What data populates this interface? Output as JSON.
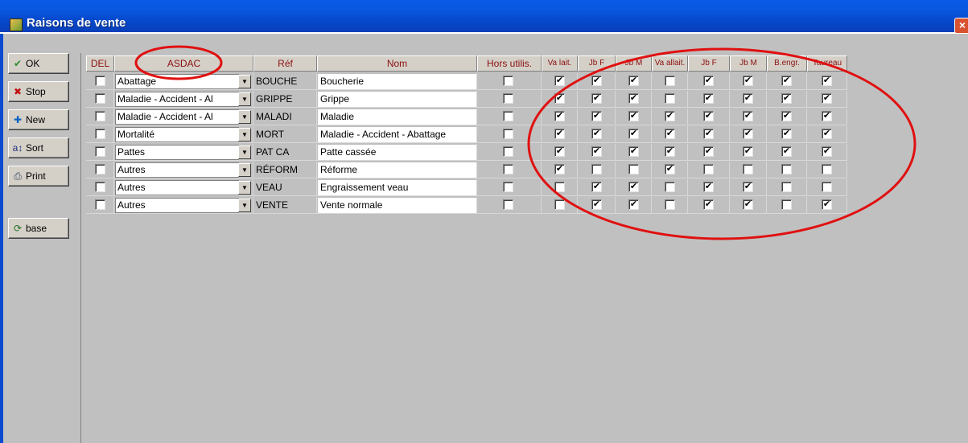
{
  "window": {
    "title": "Raisons de vente",
    "close_glyph": "×"
  },
  "toolbar": {
    "buttons": [
      {
        "label": "OK",
        "icon": "checkmark-icon"
      },
      {
        "label": "Stop",
        "icon": "stop-icon"
      },
      {
        "label": "New",
        "icon": "new-icon"
      },
      {
        "label": "Sort",
        "icon": "sort-icon"
      },
      {
        "label": "Print",
        "icon": "printer-icon"
      },
      {
        "label": "base",
        "icon": "database-icon"
      }
    ]
  },
  "grid": {
    "headers": [
      "DEL",
      "ASDAC",
      "Réf",
      "Nom",
      "Hors utilis.",
      "Va lait.",
      "Jb F",
      "Jb M",
      "Va allait.",
      "Jb F",
      "Jb M",
      "B.engr.",
      "Taureau"
    ],
    "rows": [
      {
        "del": false,
        "asdac": "Abattage",
        "ref": "BOUCHE",
        "nom": "Boucherie",
        "hors": false,
        "flags": [
          true,
          true,
          true,
          false,
          true,
          true,
          true,
          true
        ]
      },
      {
        "del": false,
        "asdac": "Maladie - Accident - Al",
        "ref": "GRIPPE",
        "nom": "Grippe",
        "hors": false,
        "flags": [
          true,
          true,
          true,
          false,
          true,
          true,
          true,
          true
        ]
      },
      {
        "del": false,
        "asdac": "Maladie - Accident - Al",
        "ref": "MALADI",
        "nom": "Maladie",
        "hors": false,
        "flags": [
          true,
          true,
          true,
          true,
          true,
          true,
          true,
          true
        ]
      },
      {
        "del": false,
        "asdac": "Mortalité",
        "ref": "MORT",
        "nom": "Maladie - Accident - Abattage",
        "hors": false,
        "flags": [
          true,
          true,
          true,
          true,
          true,
          true,
          true,
          true
        ]
      },
      {
        "del": false,
        "asdac": "Pattes",
        "ref": "PAT CA",
        "nom": "Patte cassée",
        "hors": false,
        "flags": [
          true,
          true,
          true,
          true,
          true,
          true,
          true,
          true
        ]
      },
      {
        "del": false,
        "asdac": "Autres",
        "ref": "RÉFORM",
        "nom": "Réforme",
        "hors": false,
        "flags": [
          true,
          false,
          false,
          true,
          false,
          false,
          false,
          false
        ]
      },
      {
        "del": false,
        "asdac": "Autres",
        "ref": "VEAU",
        "nom": " Engraissement veau",
        "hors": false,
        "flags": [
          false,
          true,
          true,
          false,
          true,
          true,
          false,
          false
        ]
      },
      {
        "del": false,
        "asdac": "Autres",
        "ref": "VENTE",
        "nom": "Vente normale",
        "hors": false,
        "flags": [
          false,
          true,
          true,
          false,
          true,
          true,
          false,
          true
        ]
      }
    ],
    "check_glyph": "✔",
    "dropdown_glyph": "▼"
  },
  "colors": {
    "title_bar": "#0a5ae8",
    "header_text": "#8b1010",
    "annotation": "#e01010"
  }
}
